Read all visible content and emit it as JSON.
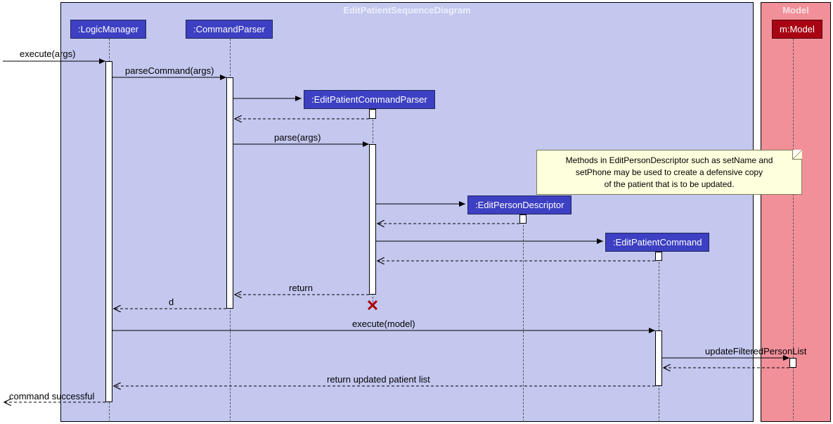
{
  "groups": {
    "logic": {
      "title": "EditPatientSequenceDiagram"
    },
    "model": {
      "title": "Model"
    }
  },
  "participants": {
    "logicManager": ":LogicManager",
    "commandParser": ":CommandParser",
    "editPatientCommandParser": ":EditPatientCommandParser",
    "editPersonDescriptor": ":EditPersonDescriptor",
    "editPatientCommand": ":EditPatientCommand",
    "model": "m:Model"
  },
  "messages": {
    "execute_args": "execute(args)",
    "parseCommand": "parseCommand(args)",
    "parse": "parse(args)",
    "return1": "return",
    "d": "d",
    "executeModel": "execute(model)",
    "updateList": "updateFilteredPersonList",
    "returnUpdated": "return updated patient list",
    "commandSuccess": "command successful"
  },
  "note": {
    "line1": "Methods in EditPersonDescriptor such as setName and",
    "line2": "setPhone may be used to create a defensive copy",
    "line3": "of the patient that is to be updated."
  },
  "chart_data": {
    "type": "sequence-diagram",
    "title": "EditPatientSequenceDiagram",
    "groups": [
      {
        "name": "EditPatientSequenceDiagram",
        "color": "#c4c8ef",
        "participants": [
          ":LogicManager",
          ":CommandParser",
          ":EditPatientCommandParser",
          ":EditPersonDescriptor",
          ":EditPatientCommand"
        ]
      },
      {
        "name": "Model",
        "color": "#f2909a",
        "participants": [
          "m:Model"
        ]
      }
    ],
    "participants": [
      ":LogicManager",
      ":CommandParser",
      ":EditPatientCommandParser",
      ":EditPersonDescriptor",
      ":EditPatientCommand",
      "m:Model"
    ],
    "messages": [
      {
        "from": "external",
        "to": ":LogicManager",
        "label": "execute(args)",
        "type": "sync"
      },
      {
        "from": ":LogicManager",
        "to": ":CommandParser",
        "label": "parseCommand(args)",
        "type": "sync"
      },
      {
        "from": ":CommandParser",
        "to": ":EditPatientCommandParser",
        "label": "",
        "type": "create"
      },
      {
        "from": ":EditPatientCommandParser",
        "to": ":CommandParser",
        "label": "",
        "type": "return"
      },
      {
        "from": ":CommandParser",
        "to": ":EditPatientCommandParser",
        "label": "parse(args)",
        "type": "sync"
      },
      {
        "from": ":EditPatientCommandParser",
        "to": ":EditPersonDescriptor",
        "label": "",
        "type": "create"
      },
      {
        "from": ":EditPersonDescriptor",
        "to": ":EditPatientCommandParser",
        "label": "",
        "type": "return"
      },
      {
        "from": ":EditPatientCommandParser",
        "to": ":EditPatientCommand",
        "label": "",
        "type": "create"
      },
      {
        "from": ":EditPatientCommand",
        "to": ":EditPatientCommandParser",
        "label": "",
        "type": "return"
      },
      {
        "from": ":EditPatientCommandParser",
        "to": ":CommandParser",
        "label": "return",
        "type": "return"
      },
      {
        "from": ":EditPatientCommandParser",
        "to": "destroy",
        "label": "",
        "type": "destroy"
      },
      {
        "from": ":CommandParser",
        "to": ":LogicManager",
        "label": "d",
        "type": "return"
      },
      {
        "from": ":LogicManager",
        "to": ":EditPatientCommand",
        "label": "execute(model)",
        "type": "sync"
      },
      {
        "from": ":EditPatientCommand",
        "to": "m:Model",
        "label": "updateFilteredPersonList",
        "type": "sync"
      },
      {
        "from": "m:Model",
        "to": ":EditPatientCommand",
        "label": "",
        "type": "return"
      },
      {
        "from": ":EditPatientCommand",
        "to": ":LogicManager",
        "label": "return updated patient list",
        "type": "return"
      },
      {
        "from": ":LogicManager",
        "to": "external",
        "label": "command successful",
        "type": "return"
      }
    ],
    "note": {
      "attached_near": ":EditPersonDescriptor",
      "text": "Methods in EditPersonDescriptor such as setName and setPhone may be used to create a defensive copy of the patient that is to be updated."
    }
  }
}
